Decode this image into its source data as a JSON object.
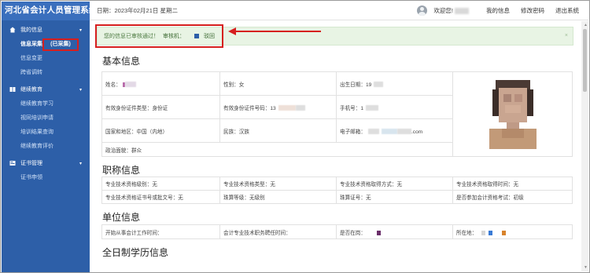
{
  "app": {
    "title": "河北省会计人员管理系统"
  },
  "sidebar": {
    "sections": [
      {
        "label": "我的信息",
        "caret": "▾",
        "items": [
          {
            "label": "信息采集",
            "badge": "(已采集)",
            "active": true
          },
          {
            "label": "信息变更"
          },
          {
            "label": "跨省调转"
          }
        ]
      },
      {
        "label": "继续教育",
        "caret": "▾",
        "items": [
          {
            "label": "继续教育学习"
          },
          {
            "label": "视同培训申请"
          },
          {
            "label": "培训结果查询"
          },
          {
            "label": "继续教育评价"
          }
        ]
      },
      {
        "label": "证书管理",
        "caret": "▾",
        "items": [
          {
            "label": "证书申领"
          }
        ]
      }
    ]
  },
  "topbar": {
    "date": "日期：2023年02月21日 星期二",
    "welcome": "欢迎您!",
    "links": [
      "我的信息",
      "修改密码",
      "退出系统"
    ]
  },
  "alert": {
    "text": "您的信息已审核通过！",
    "reviewer": "审核机：",
    "reject_label": "驳回",
    "close": "×"
  },
  "sections": {
    "basic": {
      "title": "基本信息",
      "rows": [
        [
          "姓名：",
          "性别：女",
          "出生日期：19"
        ],
        [
          "有效身份证件类型：身份证",
          "有效身份证件号码：13",
          "手机号：1"
        ],
        [
          "国家和地区：中国（内地）",
          "民族：汉族",
          "电子邮箱：",
          ".com"
        ],
        [
          "政治面貌：群众"
        ]
      ]
    },
    "title_info": {
      "title": "职称信息",
      "rows": [
        [
          "专业技术资格级别：无",
          "专业技术资格类型：无",
          "专业技术资格取得方式：无",
          "专业技术资格取得时间：无"
        ],
        [
          "专业技术资格证书号或批文号：无",
          "珠算等级：无级别",
          "珠算证号：无",
          "是否参加会计资格考试：初级"
        ]
      ]
    },
    "unit": {
      "title": "单位信息",
      "rows": [
        [
          "开始从事会计工作时间：",
          "会计专业技术职务聘任时间：",
          "是否在岗：",
          "所在地："
        ]
      ]
    },
    "education": {
      "title": "全日制学历信息"
    }
  },
  "colors": {
    "sidebar_bg": "#2d5fa8",
    "brand_bg": "#3a6fbd",
    "alert_bg": "#e8f4e4",
    "highlight": "#d61f1f"
  }
}
